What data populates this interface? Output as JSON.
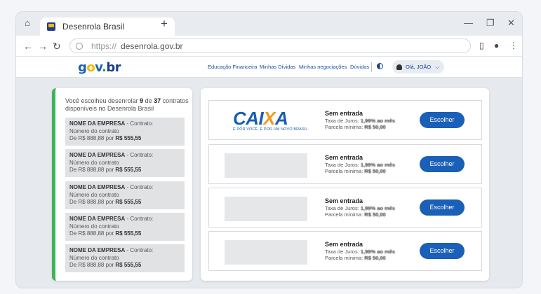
{
  "browser": {
    "tab_title": "Desenrola Brasil",
    "new_tab": "+",
    "url_scheme": "https://",
    "url_host": "desenrola.gov.br",
    "icons": [
      "home-icon",
      "back-icon",
      "forward-icon",
      "reload-icon",
      "sidebar-icon",
      "profile-icon",
      "more-icon",
      "minimize-icon",
      "restore-icon",
      "close-icon"
    ]
  },
  "header": {
    "logo": {
      "g": "g",
      "o": "o",
      "v": "v",
      "dot": ".",
      "br": "br"
    },
    "menu": [
      "Educação Financeira",
      "Minhas Dívidas",
      "Minhas negociações",
      "Dúvidas"
    ],
    "user_greeting": "Olá, JOÃO"
  },
  "summary": {
    "prefix": "Você escolheu desenrolar ",
    "chosen": "9",
    "middle": " de ",
    "total": "37",
    "suffix": " contratos disponíveis no Desenrola Brasil"
  },
  "contracts": [
    {
      "company": "NOME DA EMPRESA",
      "contract": " - Contrato:",
      "number": "Número do contrato",
      "from": "De R$ 888,88 por ",
      "to": "R$ 555,55"
    },
    {
      "company": "NOME DA EMPRESA",
      "contract": " - Contrato:",
      "number": "Número do contrato",
      "from": "De R$ 888,88 por ",
      "to": "R$ 555,55"
    },
    {
      "company": "NOME DA EMPRESA",
      "contract": " - Contrato:",
      "number": "Número do contrato",
      "from": "De R$ 888,88 por ",
      "to": "R$ 555,55"
    },
    {
      "company": "NOME DA EMPRESA",
      "contract": " - Contrato:",
      "number": "Número do contrato",
      "from": "De R$ 888,88 por ",
      "to": "R$ 555,55"
    },
    {
      "company": "NOME DA EMPRESA",
      "contract": " - Contrato:",
      "number": "Número do contrato",
      "from": "De R$ 888,88 por ",
      "to": "R$ 555,55"
    }
  ],
  "offers": [
    {
      "bank": "CAIXA",
      "bank_slogan": "É POR VOCÊ. É POR UM NOVO BRASIL.",
      "title": "Sem entrada",
      "rate_label": "Taxa de Juros: ",
      "rate": "1,99% ao mês",
      "min_label": "Parcela mínima: ",
      "min": "R$ 50,00",
      "button": "Escolher"
    },
    {
      "bank": "",
      "title": "Sem entrada",
      "rate_label": "Taxa de Juros: ",
      "rate": "1,99% ao mês",
      "min_label": "Parcela mínima: ",
      "min": "R$ 50,00",
      "button": "Escolher"
    },
    {
      "bank": "",
      "title": "Sem entrada",
      "rate_label": "Taxa de Juros: ",
      "rate": "1,99% ao mês",
      "min_label": "Parcela mínima: ",
      "min": "R$ 50,00",
      "button": "Escolher"
    },
    {
      "bank": "",
      "title": "Sem entrada",
      "rate_label": "Taxa de Juros: ",
      "rate": "1,99% ao mês",
      "min_label": "Parcela mínima: ",
      "min": "R$ 50,00",
      "button": "Escolher"
    }
  ],
  "colors": {
    "accent": "#1a5fb8",
    "green_bar": "#3db458",
    "gov_blue": "#1a3f8c"
  }
}
